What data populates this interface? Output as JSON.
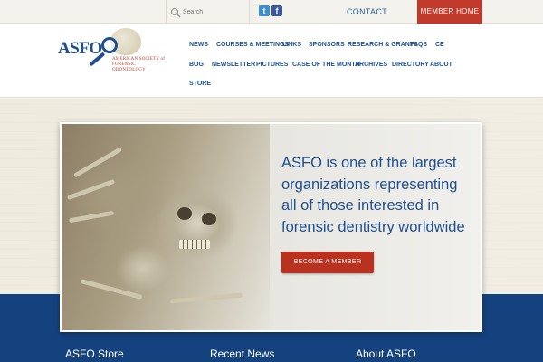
{
  "topbar": {
    "search_placeholder": "Search",
    "contact_label": "CONTACT",
    "member_home_label": "MEMBER HOME",
    "social": {
      "twitter_glyph": "t",
      "facebook_glyph": "f"
    }
  },
  "logo": {
    "wordmark": "ASFO",
    "tagline_line1": "AMERICAN SOCIETY of",
    "tagline_line2": "FORENSIC ODONTOLOGY"
  },
  "nav": {
    "items": [
      {
        "label": "NEWS"
      },
      {
        "label": "COURSES & MEETINGS"
      },
      {
        "label": "LINKS"
      },
      {
        "label": "SPONSORS"
      },
      {
        "label": "RESEARCH & GRANTS"
      },
      {
        "label": "FAQS"
      },
      {
        "label": "CE"
      },
      {
        "label": "BOG"
      },
      {
        "label": "NEWSLETTER"
      },
      {
        "label": "PICTURES"
      },
      {
        "label": "CASE OF THE MONTH"
      },
      {
        "label": "ARCHIVES"
      },
      {
        "label": "DIRECTORY"
      },
      {
        "label": "ABOUT"
      },
      {
        "label": "STORE"
      }
    ]
  },
  "hero": {
    "headline": "ASFO is one of the largest organizations representing all of those interested in forensic dentistry worldwide",
    "cta_label": "BECOME A MEMBER"
  },
  "footer": {
    "columns": [
      {
        "title": "ASFO Store"
      },
      {
        "title": "Recent News"
      },
      {
        "title": "About ASFO"
      }
    ]
  },
  "colors": {
    "brand_blue": "#1f4f8f",
    "accent_red": "#c0392b",
    "band_blue": "#14427f"
  }
}
